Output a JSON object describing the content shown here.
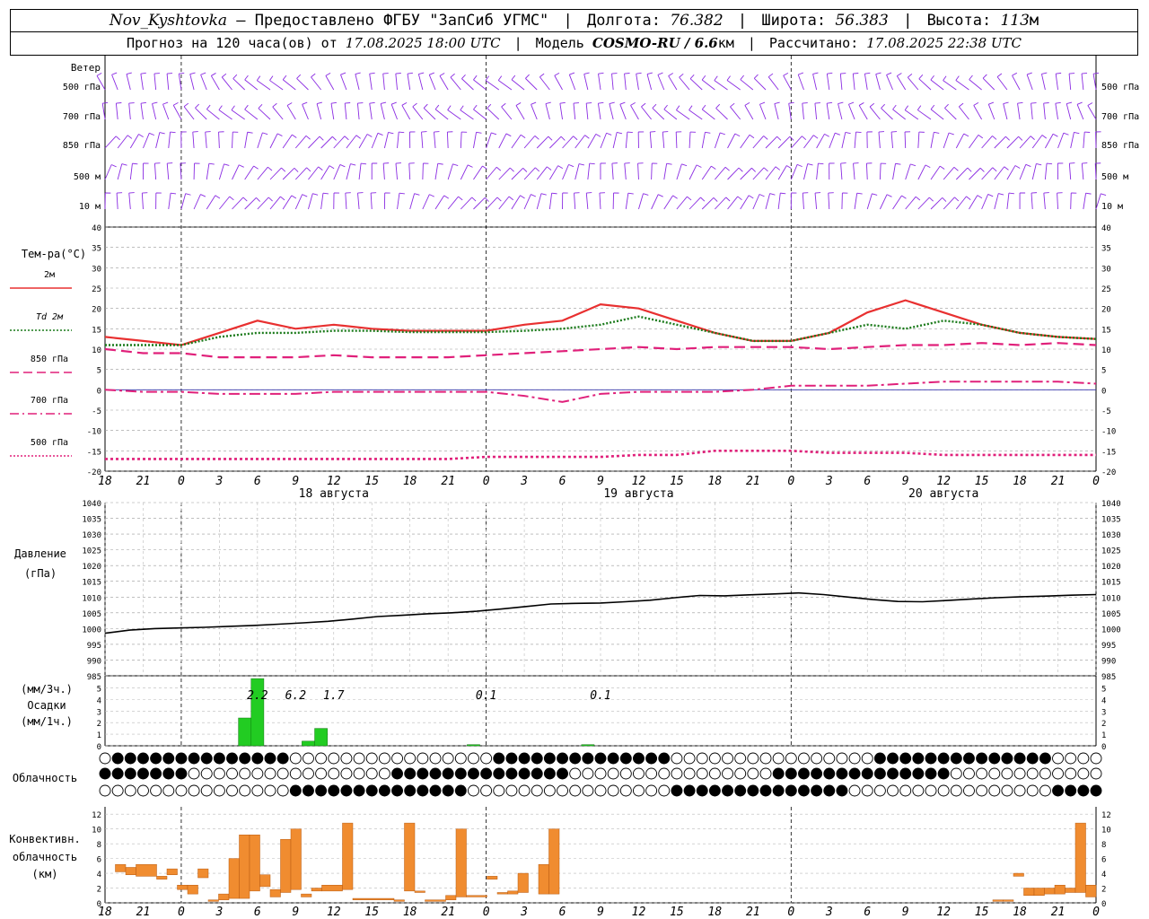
{
  "header": {
    "station": "Nov_Kyshtovka",
    "dash": "—",
    "provider": "Предоставлено ФГБУ \"ЗапСиб УГМС\"",
    "lon_label": "Долгота:",
    "lon_value": "76.382",
    "lat_label": "Широта:",
    "lat_value": "56.383",
    "alt_label": "Высота:",
    "alt_value": "113",
    "alt_unit": "м",
    "forecast_label": "Прогноз на 120 часа(ов) от",
    "forecast_start": "17.08.2025 18:00 UTC",
    "model_label": "Модель",
    "model_name": "COSMO-RU / 6.6",
    "model_unit": "км",
    "calc_label": "Рассчитано:",
    "calc_time": "17.08.2025 22:38 UTC"
  },
  "time_axis": {
    "hour_labels": [
      "18",
      "21",
      "0",
      "3",
      "6",
      "9",
      "12",
      "15",
      "18",
      "21",
      "0",
      "3",
      "6",
      "9",
      "12",
      "15",
      "18",
      "21",
      "0",
      "3",
      "6",
      "9",
      "12",
      "15",
      "18",
      "21",
      "0"
    ],
    "date_labels": [
      "18 августа",
      "19 августа",
      "20 августа"
    ]
  },
  "wind_panel": {
    "title": "Ветер",
    "levels": [
      "500 гПа",
      "700 гПа",
      "850 гПа",
      "500 м",
      "10  м"
    ],
    "barb_color": "#8a2be2"
  },
  "temp_panel": {
    "title": "Тем-ра(°C)",
    "y_ticks": [
      "40",
      "35",
      "30",
      "25",
      "20",
      "15",
      "10",
      "5",
      "0",
      "-5",
      "-10",
      "-15",
      "-20"
    ],
    "legend": [
      {
        "label": "2м",
        "color": "#e83030",
        "style": "solid"
      },
      {
        "label": "Td  2м",
        "color": "#1a7a1a",
        "style": "dotted"
      },
      {
        "label": "850 гПа",
        "color": "#e0207a",
        "style": "dashed"
      },
      {
        "label": "700 гПа",
        "color": "#e0207a",
        "style": "dashdot"
      },
      {
        "label": "500 гПа",
        "color": "#e0207a",
        "style": "dotted"
      }
    ]
  },
  "pressure_panel": {
    "title_line1": "Давление",
    "title_line2": "(гПа)",
    "y_ticks": [
      "1040",
      "1035",
      "1030",
      "1025",
      "1020",
      "1015",
      "1010",
      "1005",
      "1000",
      "995",
      "990",
      "985"
    ]
  },
  "precip_panel": {
    "unit_3h": "(мм/3ч.)",
    "title": "Осадки",
    "unit_1h": "(мм/1ч.)",
    "y_ticks": [
      "5",
      "4",
      "3",
      "2",
      "1",
      "0"
    ],
    "totals": [
      {
        "t": 12,
        "label": "2.2"
      },
      {
        "t": 15,
        "label": "6.2"
      },
      {
        "t": 18,
        "label": "1.7"
      },
      {
        "t": 30,
        "label": "0.1"
      },
      {
        "t": 39,
        "label": "0.1"
      }
    ],
    "bar_color": "#22cc22"
  },
  "cloud_panel": {
    "title": "Облачность"
  },
  "convective_panel": {
    "title_line1": "Конвективн.",
    "title_line2": "облачность",
    "title_line3": "(км)",
    "y_ticks": [
      "12",
      "10",
      "8",
      "6",
      "4",
      "2",
      "0"
    ],
    "bar_color": "#f08c30"
  },
  "chart_data": {
    "type": "line",
    "x": [
      "17.08 18",
      "17.08 21",
      "18.08 00",
      "18.08 03",
      "18.08 06",
      "18.08 09",
      "18.08 12",
      "18.08 15",
      "18.08 18",
      "18.08 21",
      "19.08 00",
      "19.08 03",
      "19.08 06",
      "19.08 09",
      "19.08 12",
      "19.08 15",
      "19.08 18",
      "19.08 21",
      "20.08 00",
      "20.08 03",
      "20.08 06",
      "20.08 09",
      "20.08 12",
      "20.08 15",
      "20.08 18",
      "20.08 21",
      "21.08 00"
    ],
    "series": [
      {
        "name": "2м",
        "values": [
          13,
          12,
          11,
          14,
          17,
          15,
          16,
          15,
          14.5,
          14.5,
          14.5,
          16,
          17,
          21,
          20,
          17,
          14,
          12,
          12,
          14,
          19,
          22,
          19,
          16,
          14,
          13,
          12.5
        ]
      },
      {
        "name": "Td  2м",
        "values": [
          11,
          11,
          11,
          13,
          14,
          14,
          14.5,
          14.5,
          14.2,
          14.2,
          14.2,
          14.5,
          15,
          16,
          18,
          16,
          14,
          12,
          12,
          14,
          16,
          15,
          17,
          16,
          14,
          13,
          12.5
        ]
      },
      {
        "name": "850 гПа",
        "values": [
          10,
          9,
          9,
          8,
          8,
          8,
          8.5,
          8,
          8,
          8,
          8.5,
          9,
          9.5,
          10,
          10.5,
          10,
          10.5,
          10.5,
          10.5,
          10,
          10.5,
          11,
          11,
          11.5,
          11,
          11.5,
          11
        ]
      },
      {
        "name": "700 гПа",
        "values": [
          0,
          -0.5,
          -0.5,
          -1,
          -1,
          -1,
          -0.5,
          -0.5,
          -0.5,
          -0.5,
          -0.5,
          -1.5,
          -3,
          -1,
          -0.5,
          -0.5,
          -0.5,
          0,
          1,
          1,
          1,
          1.5,
          2,
          2,
          2,
          2,
          1.5
        ]
      },
      {
        "name": "500 гПа",
        "values": [
          -17,
          -17,
          -17,
          -17,
          -17,
          -17,
          -17,
          -17,
          -17,
          -17,
          -16.5,
          -16.5,
          -16.5,
          -16.5,
          -16,
          -16,
          -15,
          -15,
          -15,
          -15.5,
          -15.5,
          -15.5,
          -16,
          -16,
          -16,
          -16,
          -16
        ]
      }
    ],
    "pressure": {
      "x": [
        0,
        3,
        6,
        9,
        12,
        15,
        18,
        21,
        24,
        27,
        30,
        33,
        36,
        39,
        42,
        45,
        48,
        51,
        54,
        57,
        60,
        63,
        66,
        69,
        72,
        75,
        78,
        81,
        84,
        87,
        90,
        93,
        96,
        99,
        102,
        105,
        108,
        111,
        114,
        117,
        120
      ],
      "values": [
        998.5,
        999.5,
        1000,
        1000.2,
        1000.4,
        1000.7,
        1001,
        1001.4,
        1001.8,
        1002.3,
        1003,
        1003.8,
        1004.2,
        1004.7,
        1005,
        1005.5,
        1006.2,
        1007,
        1007.8,
        1008,
        1008.1,
        1008.5,
        1009,
        1009.8,
        1010.5,
        1010.4,
        1010.7,
        1011,
        1011.3,
        1010.8,
        1010,
        1009.2,
        1008.6,
        1008.5,
        1008.9,
        1009.4,
        1009.8,
        1010.1,
        1010.3,
        1010.6,
        1010.8
      ]
    },
    "precip_1h": [
      {
        "t": 11,
        "v": 2.4
      },
      {
        "t": 12,
        "v": 6.2
      },
      {
        "t": 16,
        "v": 0.4
      },
      {
        "t": 17,
        "v": 1.5
      },
      {
        "t": 29,
        "v": 0.1
      },
      {
        "t": 38,
        "v": 0.1
      }
    ],
    "convective_cloud": [
      {
        "t0": 1,
        "t1": 2,
        "bottom": 4.2,
        "top": 5.2
      },
      {
        "t0": 2,
        "t1": 3,
        "bottom": 3.8,
        "top": 4.8
      },
      {
        "t0": 3,
        "t1": 5,
        "bottom": 3.6,
        "top": 5.2
      },
      {
        "t0": 5,
        "t1": 6,
        "bottom": 3.2,
        "top": 3.6
      },
      {
        "t0": 6,
        "t1": 7,
        "bottom": 3.8,
        "top": 4.6
      },
      {
        "t0": 7,
        "t1": 8,
        "bottom": 1.8,
        "top": 2.4
      },
      {
        "t0": 8,
        "t1": 9,
        "bottom": 1.2,
        "top": 2.4
      },
      {
        "t0": 9,
        "t1": 10,
        "bottom": 3.4,
        "top": 4.6
      },
      {
        "t0": 10,
        "t1": 11,
        "bottom": 0.2,
        "top": 0.4
      },
      {
        "t0": 11,
        "t1": 12,
        "bottom": 0.4,
        "top": 1.2
      },
      {
        "t0": 12,
        "t1": 13,
        "bottom": 0.6,
        "top": 6.0
      },
      {
        "t0": 13,
        "t1": 14,
        "bottom": 0.6,
        "top": 9.2
      },
      {
        "t0": 14,
        "t1": 15,
        "bottom": 1.6,
        "top": 9.2
      },
      {
        "t0": 15,
        "t1": 16,
        "bottom": 2.2,
        "top": 3.8
      },
      {
        "t0": 16,
        "t1": 17,
        "bottom": 0.8,
        "top": 1.8
      },
      {
        "t0": 17,
        "t1": 18,
        "bottom": 1.4,
        "top": 8.6
      },
      {
        "t0": 18,
        "t1": 19,
        "bottom": 1.8,
        "top": 10
      },
      {
        "t0": 19,
        "t1": 20,
        "bottom": 0.8,
        "top": 1.2
      },
      {
        "t0": 20,
        "t1": 21,
        "bottom": 1.6,
        "top": 2.0
      },
      {
        "t0": 21,
        "t1": 23,
        "bottom": 1.6,
        "top": 2.4
      },
      {
        "t0": 23,
        "t1": 24,
        "bottom": 1.8,
        "top": 10.8
      },
      {
        "t0": 24,
        "t1": 28,
        "bottom": 0.4,
        "top": 0.6
      },
      {
        "t0": 28,
        "t1": 29,
        "bottom": 0.2,
        "top": 0.4
      },
      {
        "t0": 29,
        "t1": 30,
        "bottom": 1.6,
        "top": 10.8
      },
      {
        "t0": 30,
        "t1": 31,
        "bottom": 1.4,
        "top": 1.6
      },
      {
        "t0": 31,
        "t1": 33,
        "bottom": 0.2,
        "top": 0.4
      },
      {
        "t0": 33,
        "t1": 34,
        "bottom": 0.4,
        "top": 1.0
      },
      {
        "t0": 34,
        "t1": 35,
        "bottom": 0.8,
        "top": 10.0
      },
      {
        "t0": 35,
        "t1": 37,
        "bottom": 0.8,
        "top": 1.0
      },
      {
        "t0": 37,
        "t1": 38,
        "bottom": 3.2,
        "top": 3.6
      },
      {
        "t0": 38,
        "t1": 39,
        "bottom": 1.2,
        "top": 1.4
      },
      {
        "t0": 39,
        "t1": 40,
        "bottom": 1.2,
        "top": 1.6
      },
      {
        "t0": 40,
        "t1": 41,
        "bottom": 1.4,
        "top": 4.0
      },
      {
        "t0": 42,
        "t1": 43,
        "bottom": 1.2,
        "top": 5.2
      },
      {
        "t0": 43,
        "t1": 44,
        "bottom": 1.2,
        "top": 10.0
      },
      {
        "t0": 86,
        "t1": 87,
        "bottom": 0.2,
        "top": 0.4
      },
      {
        "t0": 87,
        "t1": 88,
        "bottom": 0.2,
        "top": 0.4
      },
      {
        "t0": 88,
        "t1": 89,
        "bottom": 3.6,
        "top": 4.0
      },
      {
        "t0": 89,
        "t1": 90,
        "bottom": 1.0,
        "top": 2.0
      },
      {
        "t0": 90,
        "t1": 91,
        "bottom": 1.0,
        "top": 2.0
      },
      {
        "t0": 91,
        "t1": 92,
        "bottom": 1.2,
        "top": 2.0
      },
      {
        "t0": 92,
        "t1": 93,
        "bottom": 1.2,
        "top": 2.4
      },
      {
        "t0": 93,
        "t1": 94,
        "bottom": 1.4,
        "top": 2.0
      },
      {
        "t0": 94,
        "t1": 95,
        "bottom": 1.4,
        "top": 10.8
      },
      {
        "t0": 95,
        "t1": 96,
        "bottom": 0.8,
        "top": 2.4
      }
    ]
  }
}
